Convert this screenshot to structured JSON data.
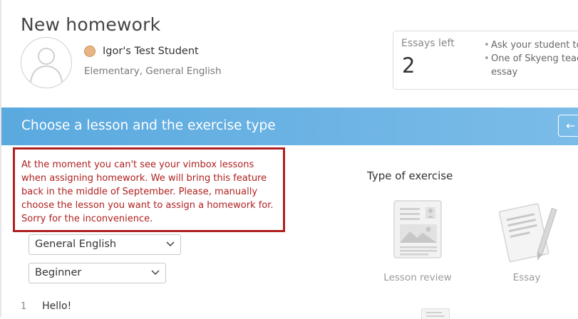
{
  "page": {
    "title": "New homework"
  },
  "student": {
    "name": "Igor's Test Student",
    "level": "Elementary, General English"
  },
  "essays": {
    "label": "Essays left",
    "count": "2",
    "notes": [
      "Ask your student to",
      "One of Skyeng teac",
      "essay"
    ]
  },
  "banner": {
    "title": "Choose a lesson and the exercise type",
    "back_icon": "arrow-left-icon"
  },
  "warning": {
    "text": "At the moment you can't see your vimbox lessons when assigning homework. We will bring this feature back in the middle of September. Please, manually choose the lesson you want to assign a homework for. Sorry for the inconvenience."
  },
  "filters": {
    "course": {
      "selected": "General English"
    },
    "level": {
      "selected": "Beginner"
    }
  },
  "lessons": [
    {
      "number": "1",
      "name": "Hello!"
    }
  ],
  "exercise_types": {
    "title": "Type of exercise",
    "items": [
      {
        "label": "Lesson review",
        "icon": "lesson-review-icon"
      },
      {
        "label": "Essay",
        "icon": "essay-icon"
      }
    ]
  },
  "colors": {
    "banner_start": "#5aa9df",
    "banner_end": "#7bbce8",
    "warning": "#b02020"
  }
}
